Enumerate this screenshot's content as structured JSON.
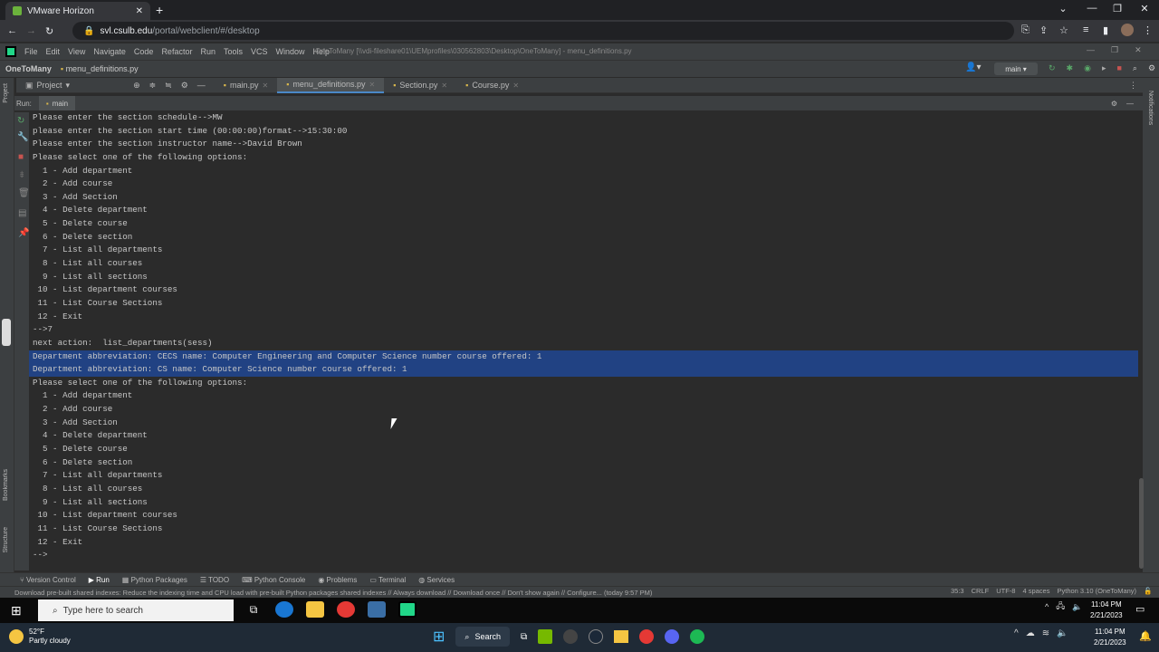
{
  "browser": {
    "tab_title": "VMware Horizon",
    "url_host": "svl.csulb.edu",
    "url_path": "/portal/webclient/#/desktop"
  },
  "ide": {
    "menu": [
      "File",
      "Edit",
      "View",
      "Navigate",
      "Code",
      "Refactor",
      "Run",
      "Tools",
      "VCS",
      "Window",
      "Help"
    ],
    "window_title": "OneToMany [\\\\vdi-fileshare01\\UEMprofiles\\030562803\\Desktop\\OneToMany] - menu_definitions.py",
    "project_name": "OneToMany",
    "current_file": "menu_definitions.py",
    "project_dropdown": "Project",
    "run_config": "main",
    "editor_tabs": [
      "main.py",
      "menu_definitions.py",
      "Section.py",
      "Course.py"
    ],
    "run_label": "Run:",
    "run_tab": "main",
    "left_strip_labels": [
      "Project",
      "Bookmarks",
      "Structure"
    ],
    "right_strip_label": "Notifications"
  },
  "console_lines": [
    "Please enter the section schedule-->MW",
    "please enter the section start time (00:00:00)format-->15:30:00",
    "Please enter the section instructor name-->David Brown",
    "Please select one of the following options:",
    "  1 - Add department",
    "  2 - Add course",
    "  3 - Add Section",
    "  4 - Delete department",
    "  5 - Delete course",
    "  6 - Delete section",
    "  7 - List all departments",
    "  8 - List all courses",
    "  9 - List all sections",
    " 10 - List department courses",
    " 11 - List Course Sections",
    " 12 - Exit",
    "-->7",
    "next action:  list_departments(sess)",
    "Department abbreviation: CECS name: Computer Engineering and Computer Science number course offered: 1",
    "Department abbreviation: CS name: Computer Science number course offered: 1",
    "Please select one of the following options:",
    "  1 - Add department",
    "  2 - Add course",
    "  3 - Add Section",
    "  4 - Delete department",
    "  5 - Delete course",
    "  6 - Delete section",
    "  7 - List all departments",
    "  8 - List all courses",
    "  9 - List all sections",
    " 10 - List department courses",
    " 11 - List Course Sections",
    " 12 - Exit",
    "-->"
  ],
  "selected_lines": [
    18,
    19
  ],
  "bottom_tabs": [
    "Version Control",
    "Run",
    "Python Packages",
    "TODO",
    "Python Console",
    "Problems",
    "Terminal",
    "Services"
  ],
  "status": {
    "message": "Download pre-built shared indexes: Reduce the indexing time and CPU load with pre-built Python packages shared indexes // Always download // Download once // Don't show again // Configure... (today 9:57 PM)",
    "position": "35:3",
    "line_sep": "CRLF",
    "encoding": "UTF-8",
    "indent": "4 spaces",
    "interpreter": "Python 3.10 (OneToMany)"
  },
  "vm_taskbar": {
    "search_placeholder": "Type here to search",
    "time": "11:04 PM",
    "date": "2/21/2023"
  },
  "host_taskbar": {
    "temp": "52°F",
    "weather": "Partly cloudy",
    "search_label": "Search",
    "time": "11:04 PM",
    "date": "2/21/2023"
  }
}
